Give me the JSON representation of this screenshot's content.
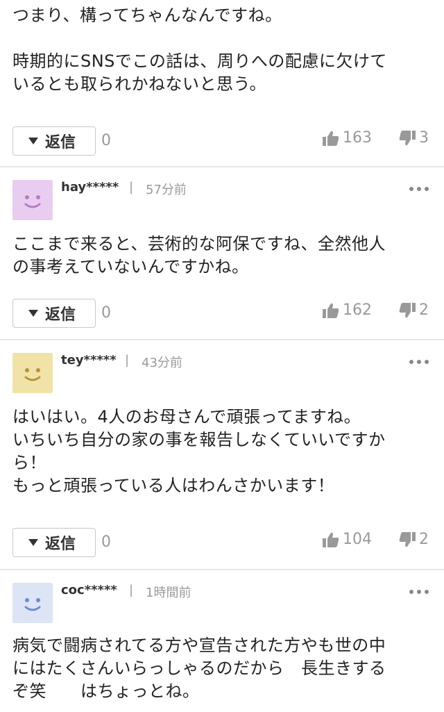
{
  "comments": [
    {
      "body": "つまり、構ってちゃんなんですね。\n\n時期的にSNSでこの話は、周りへの配慮に欠けて\nいるとも取られかねないと思う。",
      "reply_label": "返信",
      "reply_count": "0",
      "likes": "163",
      "dislikes": "3"
    },
    {
      "username": "hay*****",
      "separator": "|",
      "time": "57分前",
      "avatar_color": "#e9cdf0",
      "avatar_face_color": "#b67cc6",
      "body": "ここまで来ると、芸術的な阿保ですね、全然他人\nの事考えていないんですかね。",
      "reply_label": "返信",
      "reply_count": "0",
      "likes": "162",
      "dislikes": "2"
    },
    {
      "username": "tey*****",
      "separator": "|",
      "time": "43分前",
      "avatar_color": "#f1e3a8",
      "avatar_face_color": "#b4933a",
      "body": "はいはい。4人のお母さんで頑張ってますね。\nいちいち自分の家の事を報告しなくていいですか\nら！\nもっと頑張っている人はわんさかいます！",
      "reply_label": "返信",
      "reply_count": "0",
      "likes": "104",
      "dislikes": "2"
    },
    {
      "username": "coc*****",
      "separator": "|",
      "time": "1時間前",
      "avatar_color": "#dde4f5",
      "avatar_face_color": "#6f8bd1",
      "body": "病気で闘病されてる方や宣告された方やも世の中\nにはたくさんいらっしゃるのだから　長生きする\nぞ笑　　はちょっとね。"
    }
  ],
  "icons": {
    "like": "thumbs-up-icon",
    "dislike": "thumbs-down-icon",
    "reply_toggle": "triangle-down-icon",
    "more": "more-dots-icon"
  }
}
